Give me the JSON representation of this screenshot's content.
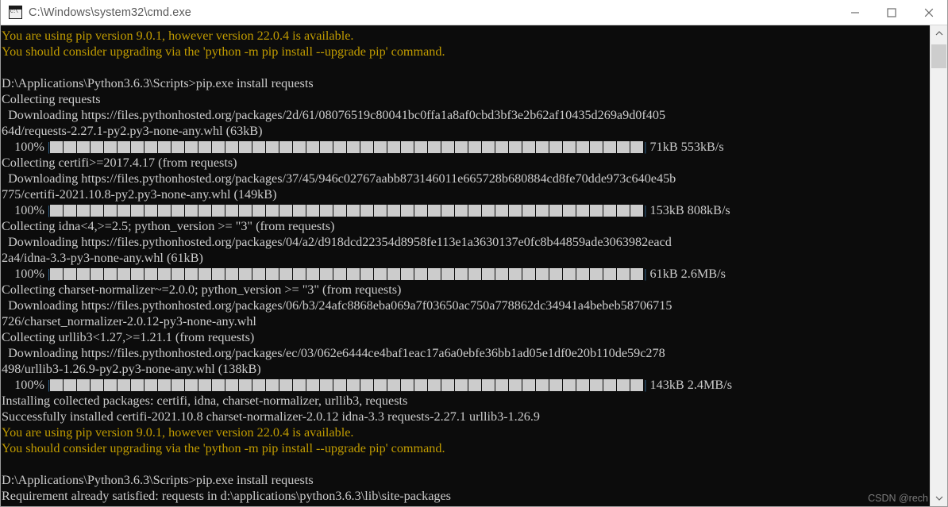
{
  "window": {
    "title": "C:\\Windows\\system32\\cmd.exe",
    "icon": "cmd-icon",
    "controls": {
      "minimize": "minimize-button",
      "maximize": "maximize-button",
      "close": "close-button"
    },
    "background_color": "#0c0c0c",
    "titlebar_color": "#ffffff"
  },
  "colors": {
    "warning_text": "#c19c00",
    "output_text": "#cccccc",
    "progress_block": "#cccccc",
    "progress_pipe": "#3b78a8"
  },
  "scrollbar": {
    "up_arrow": "scroll-up-arrow",
    "down_arrow": "scroll-down-arrow",
    "thumb_position": "top"
  },
  "watermark": {
    "text": "CSDN @rech"
  },
  "terminal": {
    "lines": [
      {
        "type": "warn",
        "text": "You are using pip version 9.0.1, however version 22.0.4 is available."
      },
      {
        "type": "warn",
        "text": "You should consider upgrading via the 'python -m pip install --upgrade pip' command."
      },
      {
        "type": "blank",
        "text": ""
      },
      {
        "type": "cmd",
        "text": "D:\\Applications\\Python3.6.3\\Scripts>pip.exe install requests"
      },
      {
        "type": "out",
        "text": "Collecting requests"
      },
      {
        "type": "out",
        "text": "  Downloading https://files.pythonhosted.org/packages/2d/61/08076519c80041bc0ffa1a8af0cbd3bf3e2b62af10435d269a9d0f405"
      },
      {
        "type": "out",
        "text": "64d/requests-2.27.1-py2.py3-none-any.whl (63kB)"
      },
      {
        "type": "progress",
        "percent": "100%",
        "indent": "    ",
        "blocks": 44,
        "trailer": " 71kB 553kB/s"
      },
      {
        "type": "out",
        "text": "Collecting certifi>=2017.4.17 (from requests)"
      },
      {
        "type": "out",
        "text": "  Downloading https://files.pythonhosted.org/packages/37/45/946c02767aabb873146011e665728b680884cd8fe70dde973c640e45b"
      },
      {
        "type": "out",
        "text": "775/certifi-2021.10.8-py2.py3-none-any.whl (149kB)"
      },
      {
        "type": "progress",
        "percent": "100%",
        "indent": "    ",
        "blocks": 44,
        "trailer": " 153kB 808kB/s"
      },
      {
        "type": "out",
        "text": "Collecting idna<4,>=2.5; python_version >= \"3\" (from requests)"
      },
      {
        "type": "out",
        "text": "  Downloading https://files.pythonhosted.org/packages/04/a2/d918dcd22354d8958fe113e1a3630137e0fc8b44859ade3063982eacd"
      },
      {
        "type": "out",
        "text": "2a4/idna-3.3-py3-none-any.whl (61kB)"
      },
      {
        "type": "progress",
        "percent": "100%",
        "indent": "    ",
        "blocks": 44,
        "trailer": " 61kB 2.6MB/s"
      },
      {
        "type": "out",
        "text": "Collecting charset-normalizer~=2.0.0; python_version >= \"3\" (from requests)"
      },
      {
        "type": "out",
        "text": "  Downloading https://files.pythonhosted.org/packages/06/b3/24afc8868eba069a7f03650ac750a778862dc34941a4bebeb58706715"
      },
      {
        "type": "out",
        "text": "726/charset_normalizer-2.0.12-py3-none-any.whl"
      },
      {
        "type": "out",
        "text": "Collecting urllib3<1.27,>=1.21.1 (from requests)"
      },
      {
        "type": "out",
        "text": "  Downloading https://files.pythonhosted.org/packages/ec/03/062e6444ce4baf1eac17a6a0ebfe36bb1ad05e1df0e20b110de59c278"
      },
      {
        "type": "out",
        "text": "498/urllib3-1.26.9-py2.py3-none-any.whl (138kB)"
      },
      {
        "type": "progress",
        "percent": "100%",
        "indent": "    ",
        "blocks": 44,
        "trailer": " 143kB 2.4MB/s"
      },
      {
        "type": "out",
        "text": "Installing collected packages: certifi, idna, charset-normalizer, urllib3, requests"
      },
      {
        "type": "out",
        "text": "Successfully installed certifi-2021.10.8 charset-normalizer-2.0.12 idna-3.3 requests-2.27.1 urllib3-1.26.9"
      },
      {
        "type": "warn",
        "text": "You are using pip version 9.0.1, however version 22.0.4 is available."
      },
      {
        "type": "warn",
        "text": "You should consider upgrading via the 'python -m pip install --upgrade pip' command."
      },
      {
        "type": "blank",
        "text": ""
      },
      {
        "type": "cmd",
        "text": "D:\\Applications\\Python3.6.3\\Scripts>pip.exe install requests"
      },
      {
        "type": "out",
        "text": "Requirement already satisfied: requests in d:\\applications\\python3.6.3\\lib\\site-packages"
      }
    ]
  }
}
